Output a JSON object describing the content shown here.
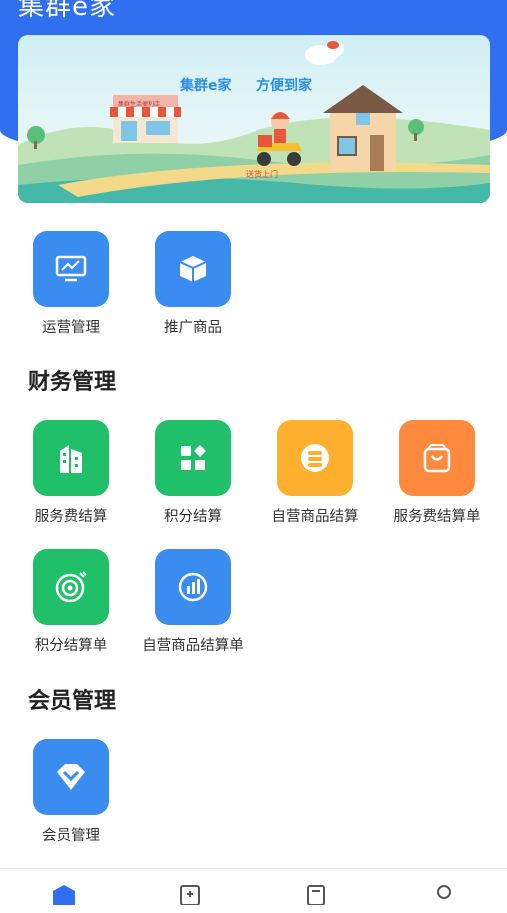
{
  "header": {
    "app_title": "集群e家"
  },
  "banner": {
    "slogan_left": "集群e家",
    "slogan_right": "方便到家",
    "delivery_caption": "送货上门",
    "shop_sign": "集群生活便利店"
  },
  "top_tiles": [
    {
      "label": "运营管理",
      "icon": "monitor-icon",
      "color": "#3a8cf0"
    },
    {
      "label": "推广商品",
      "icon": "box-icon",
      "color": "#3a8cf0"
    }
  ],
  "finance": {
    "title": "财务管理",
    "tiles": [
      {
        "label": "服务费结算",
        "icon": "building-icon",
        "color": "#20c06b"
      },
      {
        "label": "积分结算",
        "icon": "grid-icon",
        "color": "#20c06b"
      },
      {
        "label": "自营商品结算",
        "icon": "coin-stack-icon",
        "color": "#ffb02e"
      },
      {
        "label": "服务费结算单",
        "icon": "shopping-bag-icon",
        "color": "#ff8a3d"
      },
      {
        "label": "积分结算单",
        "icon": "target-icon",
        "color": "#20c06b"
      },
      {
        "label": "自营商品结算单",
        "icon": "bar-chart-icon",
        "color": "#3a8cf0"
      }
    ]
  },
  "member": {
    "title": "会员管理",
    "tiles": [
      {
        "label": "会员管理",
        "icon": "diamond-icon",
        "color": "#3a8cf0"
      }
    ]
  },
  "tabbar": {
    "tabs": [
      {
        "icon": "home-icon",
        "active": true,
        "active_color": "#2f6ff0"
      },
      {
        "icon": "chart-icon",
        "active": false
      },
      {
        "icon": "document-icon",
        "active": false
      },
      {
        "icon": "user-icon",
        "active": false
      }
    ]
  }
}
